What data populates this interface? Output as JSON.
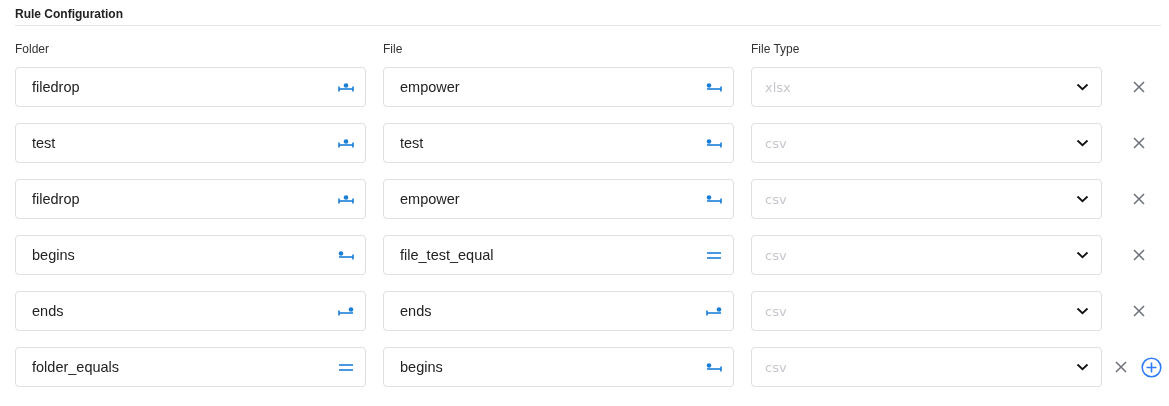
{
  "section": {
    "title": "Rule Configuration"
  },
  "columns": [
    "Folder",
    "File",
    "File Type"
  ],
  "rows": [
    {
      "folder": {
        "value": "filedrop",
        "kind": "contains"
      },
      "file": {
        "value": "empower",
        "kind": "begins"
      },
      "file_type": {
        "placeholder": "xlsx"
      },
      "can_add": false
    },
    {
      "folder": {
        "value": "test",
        "kind": "contains"
      },
      "file": {
        "value": "test",
        "kind": "begins"
      },
      "file_type": {
        "placeholder": "csv"
      },
      "can_add": false
    },
    {
      "folder": {
        "value": "filedrop",
        "kind": "contains"
      },
      "file": {
        "value": "empower",
        "kind": "begins"
      },
      "file_type": {
        "placeholder": "csv"
      },
      "can_add": false
    },
    {
      "folder": {
        "value": "begins",
        "kind": "begins"
      },
      "file": {
        "value": "file_test_equal",
        "kind": "equals"
      },
      "file_type": {
        "placeholder": "csv"
      },
      "can_add": false
    },
    {
      "folder": {
        "value": "ends",
        "kind": "ends"
      },
      "file": {
        "value": "ends",
        "kind": "ends"
      },
      "file_type": {
        "placeholder": "csv"
      },
      "can_add": false
    },
    {
      "folder": {
        "value": "folder_equals",
        "kind": "equals"
      },
      "file": {
        "value": "begins",
        "kind": "begins"
      },
      "file_type": {
        "placeholder": "csv"
      },
      "can_add": true
    }
  ]
}
